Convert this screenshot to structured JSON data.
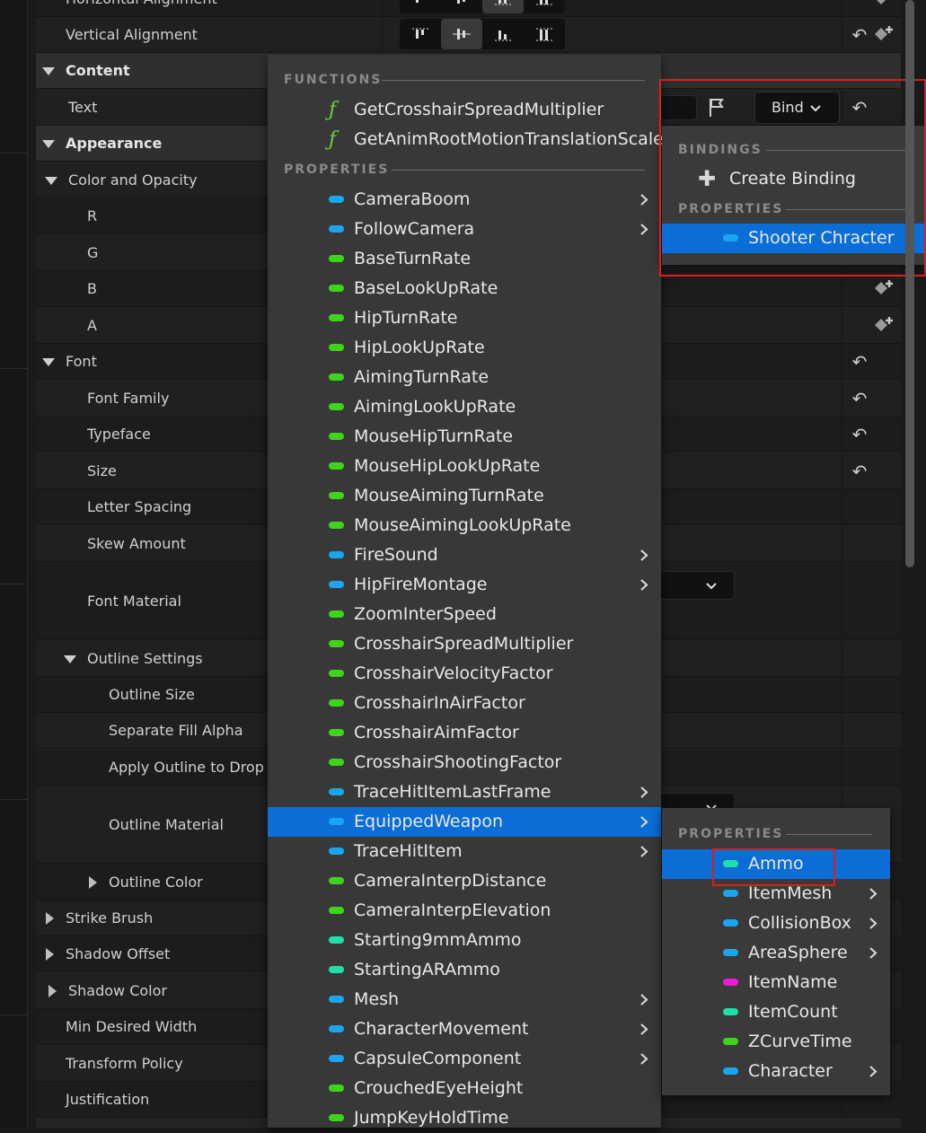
{
  "details": {
    "rows": [
      {
        "label": "Horizontal Alignment"
      },
      {
        "label": "Vertical Alignment"
      },
      {
        "label": "Content"
      },
      {
        "label": "Text"
      },
      {
        "label": "Appearance"
      },
      {
        "label": "Color and Opacity"
      },
      {
        "label": "R"
      },
      {
        "label": "G"
      },
      {
        "label": "B"
      },
      {
        "label": "A"
      },
      {
        "label": "Font"
      },
      {
        "label": "Font Family"
      },
      {
        "label": "Typeface"
      },
      {
        "label": "Size"
      },
      {
        "label": "Letter Spacing"
      },
      {
        "label": "Skew Amount"
      },
      {
        "label": "Font Material"
      },
      {
        "label": "Outline Settings"
      },
      {
        "label": "Outline Size"
      },
      {
        "label": "Separate Fill Alpha"
      },
      {
        "label": "Apply Outline to Drop Sha"
      },
      {
        "label": "Outline Material"
      },
      {
        "label": "Outline Color"
      },
      {
        "label": "Strike Brush"
      },
      {
        "label": "Shadow Offset"
      },
      {
        "label": "Shadow Color"
      },
      {
        "label": "Min Desired Width"
      },
      {
        "label": "Transform Policy"
      },
      {
        "label": "Justification"
      }
    ],
    "bind_button": {
      "label": "Bind"
    }
  },
  "main_menu": {
    "functions_header": "FUNCTIONS",
    "functions": [
      {
        "label": "GetCrosshairSpreadMultiplier"
      },
      {
        "label": "GetAnimRootMotionTranslationScale"
      }
    ],
    "properties_header": "PROPERTIES",
    "properties": [
      {
        "label": "CameraBoom",
        "color": "#1aa6ee",
        "submenu": true
      },
      {
        "label": "FollowCamera",
        "color": "#1aa6ee",
        "submenu": true
      },
      {
        "label": "BaseTurnRate",
        "color": "#3fd41c",
        "submenu": false
      },
      {
        "label": "BaseLookUpRate",
        "color": "#3fd41c",
        "submenu": false
      },
      {
        "label": "HipTurnRate",
        "color": "#3fd41c",
        "submenu": false
      },
      {
        "label": "HipLookUpRate",
        "color": "#3fd41c",
        "submenu": false
      },
      {
        "label": "AimingTurnRate",
        "color": "#3fd41c",
        "submenu": false
      },
      {
        "label": "AimingLookUpRate",
        "color": "#3fd41c",
        "submenu": false
      },
      {
        "label": "MouseHipTurnRate",
        "color": "#3fd41c",
        "submenu": false
      },
      {
        "label": "MouseHipLookUpRate",
        "color": "#3fd41c",
        "submenu": false
      },
      {
        "label": "MouseAimingTurnRate",
        "color": "#3fd41c",
        "submenu": false
      },
      {
        "label": "MouseAimingLookUpRate",
        "color": "#3fd41c",
        "submenu": false
      },
      {
        "label": "FireSound",
        "color": "#1aa6ee",
        "submenu": true
      },
      {
        "label": "HipFireMontage",
        "color": "#1aa6ee",
        "submenu": true
      },
      {
        "label": "ZoomInterSpeed",
        "color": "#3fd41c",
        "submenu": false
      },
      {
        "label": "CrosshairSpreadMultiplier",
        "color": "#3fd41c",
        "submenu": false
      },
      {
        "label": "CrosshairVelocityFactor",
        "color": "#3fd41c",
        "submenu": false
      },
      {
        "label": "CrosshairInAirFactor",
        "color": "#3fd41c",
        "submenu": false
      },
      {
        "label": "CrosshairAimFactor",
        "color": "#3fd41c",
        "submenu": false
      },
      {
        "label": "CrosshairShootingFactor",
        "color": "#3fd41c",
        "submenu": false
      },
      {
        "label": "TraceHitItemLastFrame",
        "color": "#1aa6ee",
        "submenu": true
      },
      {
        "label": "EquippedWeapon",
        "color": "#1aa6ee",
        "submenu": true,
        "selected": true
      },
      {
        "label": "TraceHitItem",
        "color": "#1aa6ee",
        "submenu": true
      },
      {
        "label": "CameraInterpDistance",
        "color": "#3fd41c",
        "submenu": false
      },
      {
        "label": "CameraInterpElevation",
        "color": "#3fd41c",
        "submenu": false
      },
      {
        "label": "Starting9mmAmmo",
        "color": "#1fe0a8",
        "submenu": false
      },
      {
        "label": "StartingARAmmo",
        "color": "#1fe0a8",
        "submenu": false
      },
      {
        "label": "Mesh",
        "color": "#1aa6ee",
        "submenu": true
      },
      {
        "label": "CharacterMovement",
        "color": "#1aa6ee",
        "submenu": true
      },
      {
        "label": "CapsuleComponent",
        "color": "#1aa6ee",
        "submenu": true
      },
      {
        "label": "CrouchedEyeHeight",
        "color": "#3fd41c",
        "submenu": false
      },
      {
        "label": "JumpKeyHoldTime",
        "color": "#3fd41c",
        "submenu": false
      }
    ]
  },
  "bind_menu": {
    "bindings_header": "BINDINGS",
    "create_binding": "Create Binding",
    "properties_header": "PROPERTIES",
    "items": [
      {
        "label": "Shooter Chracter",
        "color": "#1aa6ee",
        "submenu": true,
        "selected": true
      }
    ]
  },
  "sub_menu": {
    "properties_header": "PROPERTIES",
    "items": [
      {
        "label": "Ammo",
        "color": "#1fe0a8",
        "submenu": false,
        "selected": true
      },
      {
        "label": "ItemMesh",
        "color": "#1aa6ee",
        "submenu": true
      },
      {
        "label": "CollisionBox",
        "color": "#1aa6ee",
        "submenu": true
      },
      {
        "label": "AreaSphere",
        "color": "#1aa6ee",
        "submenu": true
      },
      {
        "label": "ItemName",
        "color": "#ee1ad4",
        "submenu": false
      },
      {
        "label": "ItemCount",
        "color": "#1fe0a8",
        "submenu": false
      },
      {
        "label": "ZCurveTime",
        "color": "#3fd41c",
        "submenu": false
      },
      {
        "label": "Character",
        "color": "#1aa6ee",
        "submenu": true
      }
    ]
  },
  "icons": {
    "reset": "reset-arrow-icon",
    "keyframe": "add-keyframe-icon",
    "flag": "flag-icon",
    "function": "function-icon",
    "plus": "plus-icon",
    "chevron_right": "chevron-right-icon",
    "chevron_down": "chevron-down-icon"
  }
}
